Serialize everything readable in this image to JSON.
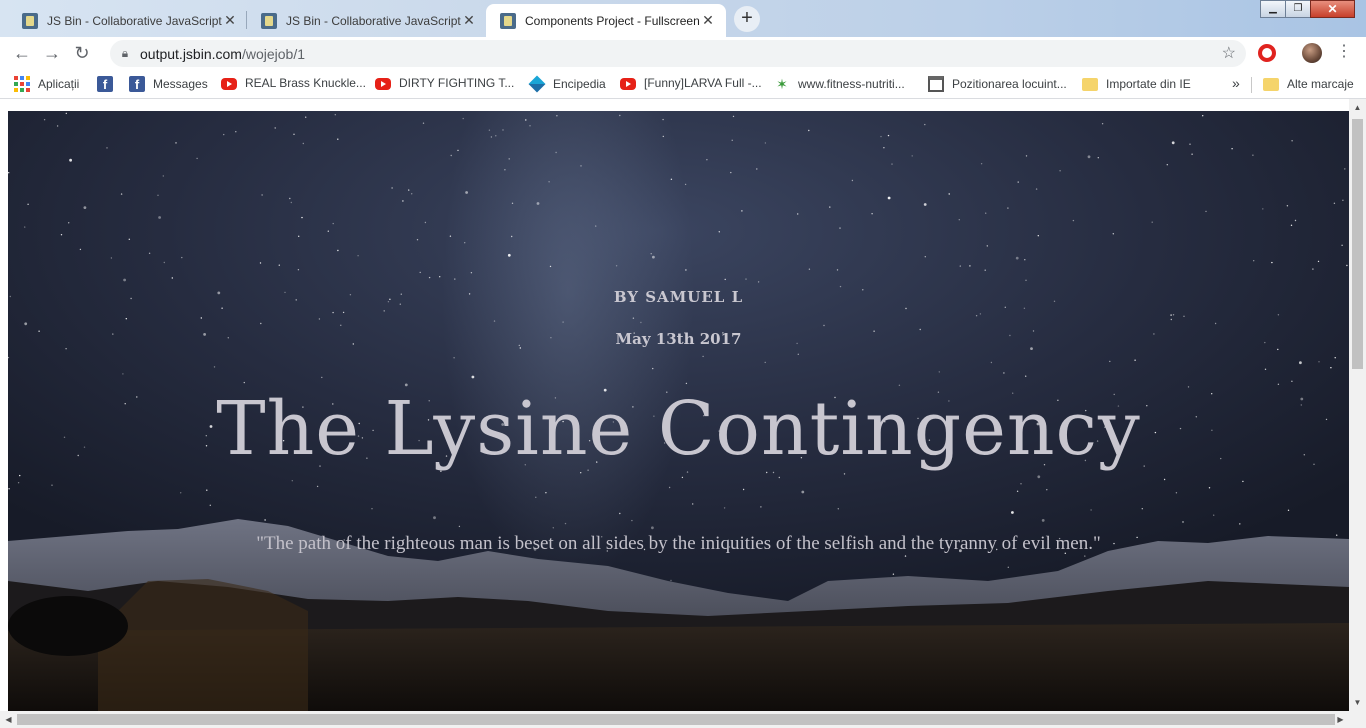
{
  "browser": {
    "tabs": [
      {
        "title": "JS Bin - Collaborative JavaScript D",
        "active": false
      },
      {
        "title": "JS Bin - Collaborative JavaScript D",
        "active": false
      },
      {
        "title": "Components Project - Fullscreen",
        "active": true
      }
    ],
    "new_tab_label": "+",
    "window_controls": {
      "minimize": "▁",
      "maximize": "❐",
      "close": "✕"
    },
    "url_host": "output.jsbin.com",
    "url_path": "/wojejob/1",
    "bookmarks": [
      {
        "label": "Aplicații",
        "icon": "apps-grid-icon"
      },
      {
        "label": "",
        "icon": "facebook-icon"
      },
      {
        "label": "Messages",
        "icon": "facebook-icon"
      },
      {
        "label": "REAL Brass Knuckle...",
        "icon": "youtube-icon"
      },
      {
        "label": "DIRTY FIGHTING T...",
        "icon": "youtube-icon"
      },
      {
        "label": "Encipedia",
        "icon": "encipedia-icon"
      },
      {
        "label": "[Funny]LARVA Full -...",
        "icon": "youtube-icon"
      },
      {
        "label": "www.fitness-nutriti...",
        "icon": "fitness-icon"
      },
      {
        "label": "Pozitionarea locuint...",
        "icon": "house-icon"
      },
      {
        "label": "Importate din IE",
        "icon": "folder-icon"
      }
    ],
    "bookmarks_overflow": "»",
    "other_bookmarks": "Alte marcaje"
  },
  "page": {
    "byline": "BY SAMUEL L",
    "date": "May 13th 2017",
    "headline": "The Lysine Contingency",
    "quote": "\"The path of the righteous man is beset on all sides by the iniquities of the selfish and the tyranny of evil men.\""
  },
  "colors": {
    "sky_top": "#2a3147",
    "sky_bottom": "#171b28",
    "text_light": "#c8c6cf",
    "close_red": "#c7402b"
  }
}
